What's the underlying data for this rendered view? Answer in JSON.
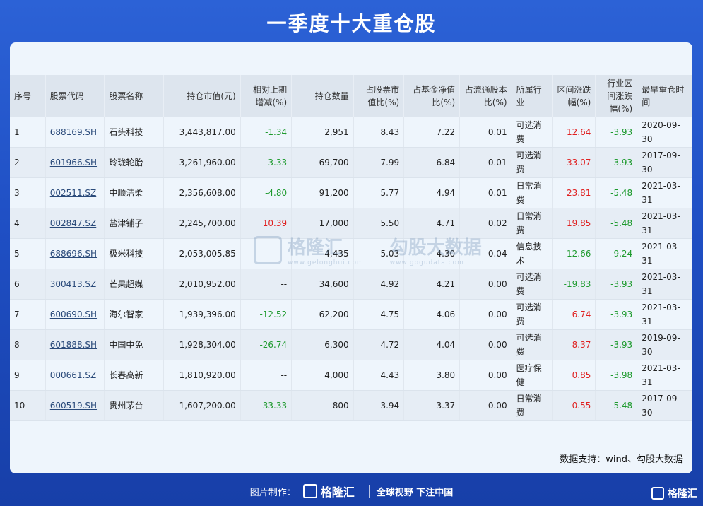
{
  "title": "一季度十大重仓股",
  "table": {
    "headers": [
      "序号",
      "股票代码",
      "股票名称",
      "持仓市值(元)",
      "相对上期增减(%)",
      "持仓数量",
      "占股票市值比(%)",
      "占基金净值比(%)",
      "占流通股本比(%)",
      "所属行业",
      "区间涨跌幅(%)",
      "行业区间涨跌幅(%)",
      "最早重仓时间"
    ],
    "rows": [
      [
        "1",
        "688169.SH",
        "石头科技",
        "3,443,817.00",
        "-1.34",
        "2,951",
        "8.43",
        "7.22",
        "0.01",
        "可选消费",
        "12.64",
        "-3.93",
        "2020-09-30"
      ],
      [
        "2",
        "601966.SH",
        "玲珑轮胎",
        "3,261,960.00",
        "-3.33",
        "69,700",
        "7.99",
        "6.84",
        "0.01",
        "可选消费",
        "33.07",
        "-3.93",
        "2017-09-30"
      ],
      [
        "3",
        "002511.SZ",
        "中顺洁柔",
        "2,356,608.00",
        "-4.80",
        "91,200",
        "5.77",
        "4.94",
        "0.01",
        "日常消费",
        "23.81",
        "-5.48",
        "2021-03-31"
      ],
      [
        "4",
        "002847.SZ",
        "盐津铺子",
        "2,245,700.00",
        "10.39",
        "17,000",
        "5.50",
        "4.71",
        "0.02",
        "日常消费",
        "19.85",
        "-5.48",
        "2021-03-31"
      ],
      [
        "5",
        "688696.SH",
        "极米科技",
        "2,053,005.85",
        "--",
        "4,435",
        "5.03",
        "4.30",
        "0.04",
        "信息技术",
        "-12.66",
        "-9.24",
        "2021-03-31"
      ],
      [
        "6",
        "300413.SZ",
        "芒果超媒",
        "2,010,952.00",
        "--",
        "34,600",
        "4.92",
        "4.21",
        "0.00",
        "可选消费",
        "-19.83",
        "-3.93",
        "2021-03-31"
      ],
      [
        "7",
        "600690.SH",
        "海尔智家",
        "1,939,396.00",
        "-12.52",
        "62,200",
        "4.75",
        "4.06",
        "0.00",
        "可选消费",
        "6.74",
        "-3.93",
        "2021-03-31"
      ],
      [
        "8",
        "601888.SH",
        "中国中免",
        "1,928,304.00",
        "-26.74",
        "6,300",
        "4.72",
        "4.04",
        "0.00",
        "可选消费",
        "8.37",
        "-3.93",
        "2019-09-30"
      ],
      [
        "9",
        "000661.SZ",
        "长春高新",
        "1,810,920.00",
        "--",
        "4,000",
        "4.43",
        "3.80",
        "0.00",
        "医疗保健",
        "0.85",
        "-3.98",
        "2021-03-31"
      ],
      [
        "10",
        "600519.SH",
        "贵州茅台",
        "1,607,200.00",
        "-33.33",
        "800",
        "3.94",
        "3.37",
        "0.00",
        "日常消费",
        "0.55",
        "-5.48",
        "2017-09-30"
      ]
    ]
  },
  "watermark": {
    "left_brand": "格隆汇",
    "left_url": "www.gelonghui.com",
    "right_brand": "勾股大数据",
    "right_url": "www.gogudata.com"
  },
  "source": "数据支持：wind、勾股大数据",
  "footer": {
    "made_by": "图片制作：",
    "brand": "格隆汇",
    "slogan": "全球视野 下注中国"
  },
  "corner_brand": "格隆汇",
  "colors": {
    "positive": "#e02020",
    "negative": "#1e9a2e",
    "code_link": "#2a4a7a",
    "background": "#1f4fc4"
  }
}
